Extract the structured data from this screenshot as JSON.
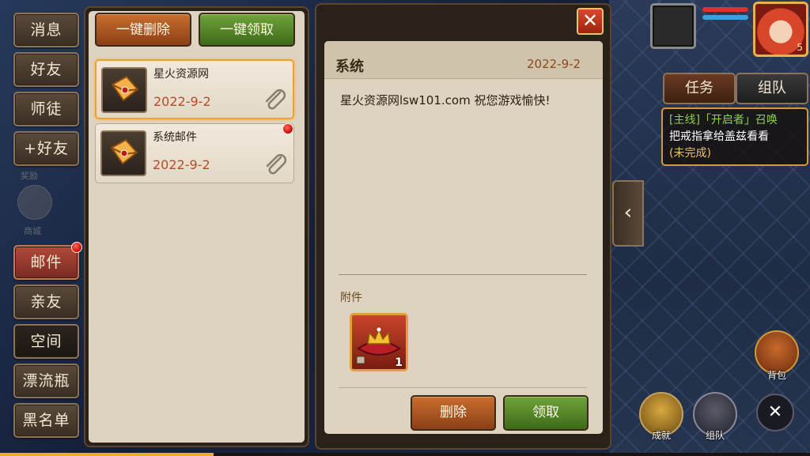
{
  "sidebar": {
    "items": [
      {
        "label": "消息"
      },
      {
        "label": "好友"
      },
      {
        "label": "师徒"
      },
      {
        "label": "+好友"
      },
      {
        "label": "邮件"
      },
      {
        "label": "亲友"
      },
      {
        "label": "空间"
      },
      {
        "label": "漂流瓶"
      },
      {
        "label": "黑名单"
      }
    ],
    "faded": [
      "奖励",
      "商城"
    ]
  },
  "mail_list": {
    "delete_all_label": "一键删除",
    "claim_all_label": "一键领取",
    "items": [
      {
        "title": "星火资源网",
        "date": "2022-9-2"
      },
      {
        "title": "系统邮件",
        "date": "2022-9-2"
      }
    ]
  },
  "detail": {
    "sender": "系统",
    "date": "2022-9-2",
    "body": "星火资源网lsw101.com 祝您游戏愉快!",
    "attachments_label": "附件",
    "attachment_count": "1",
    "delete_label": "删除",
    "claim_label": "领取",
    "close_label": "✕"
  },
  "hud": {
    "avatar_level": "5",
    "task_tab": "任务",
    "team_tab": "组队",
    "quest": {
      "tag": "[主线]「开启者」召唤",
      "desc": "把戒指拿给盖兹看看",
      "status": "(未完成)"
    },
    "bag_label": "背包",
    "achievement_label": "成就",
    "team_label": "组队",
    "arrow": "‹"
  },
  "colors": {
    "accent_orange": "#f0a030",
    "date_red": "#b84a26",
    "quest_green": "#8ed04a",
    "quest_status": "#e6c070"
  }
}
